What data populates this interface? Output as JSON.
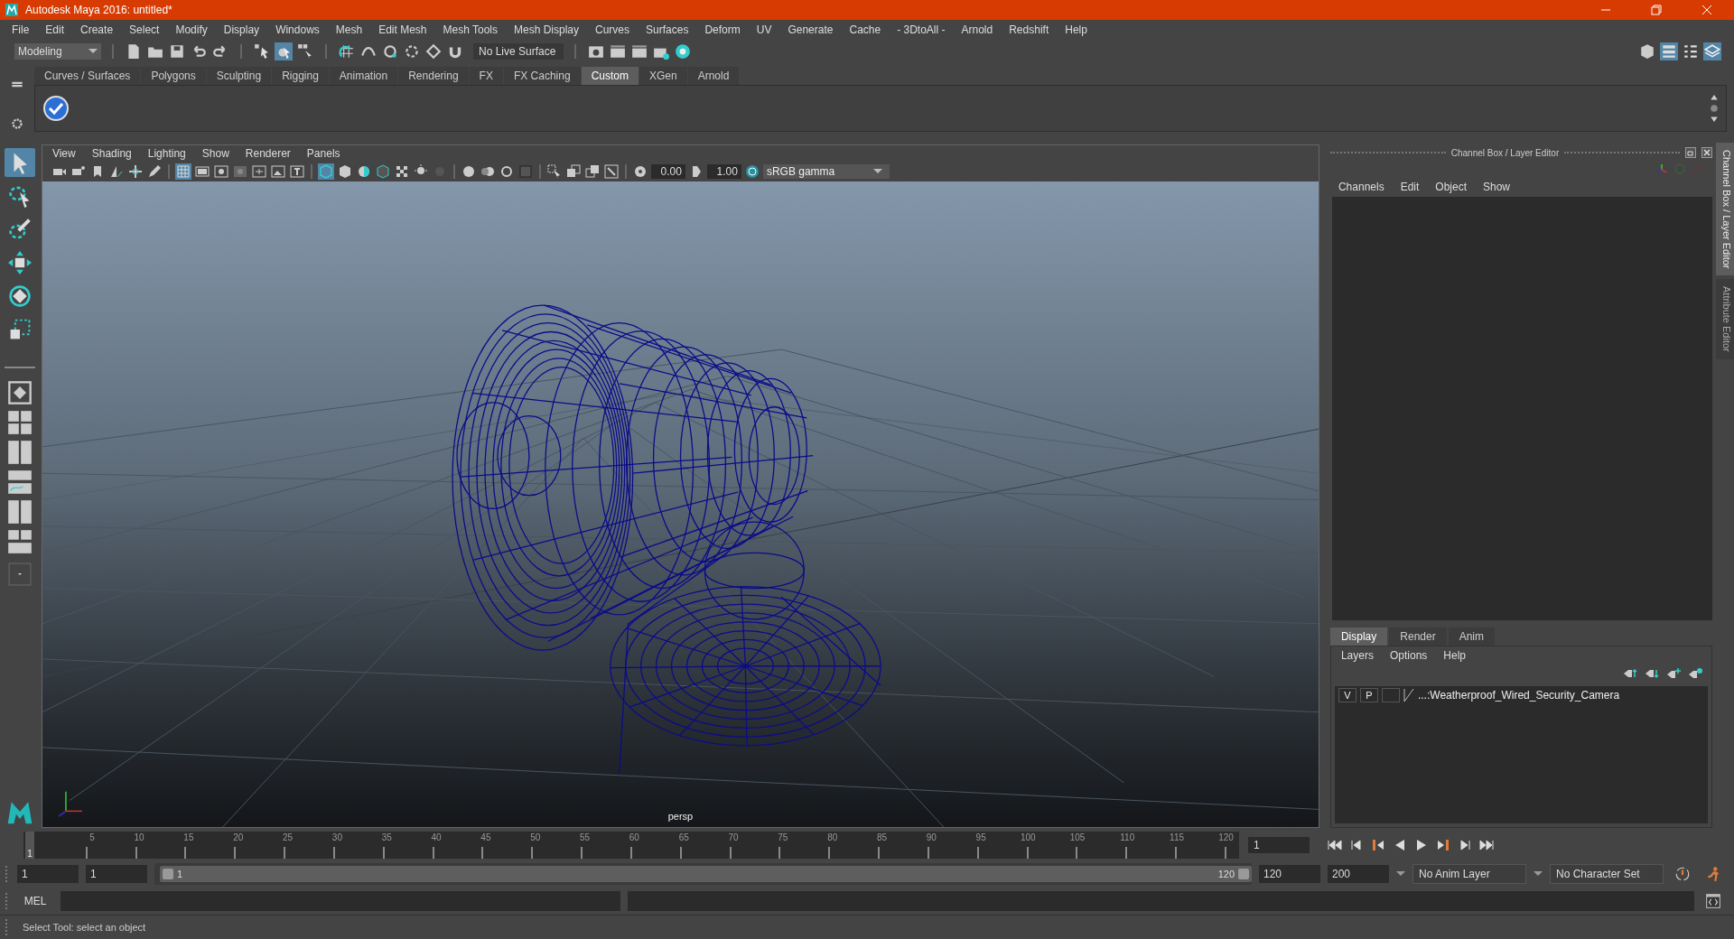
{
  "window": {
    "title": "Autodesk Maya 2016: untitled*"
  },
  "menu_bar": [
    "File",
    "Edit",
    "Create",
    "Select",
    "Modify",
    "Display",
    "Windows",
    "Mesh",
    "Edit Mesh",
    "Mesh Tools",
    "Mesh Display",
    "Curves",
    "Surfaces",
    "Deform",
    "UV",
    "Generate",
    "Cache",
    "- 3DtoAll -",
    "Arnold",
    "Redshift",
    "Help"
  ],
  "status_line": {
    "workspace": "Modeling",
    "live_surface": "No Live Surface"
  },
  "shelf_tabs": [
    {
      "label": "Curves / Surfaces",
      "selected": false
    },
    {
      "label": "Polygons",
      "selected": false
    },
    {
      "label": "Sculpting",
      "selected": false
    },
    {
      "label": "Rigging",
      "selected": false
    },
    {
      "label": "Animation",
      "selected": false
    },
    {
      "label": "Rendering",
      "selected": false
    },
    {
      "label": "FX",
      "selected": false
    },
    {
      "label": "FX Caching",
      "selected": false
    },
    {
      "label": "Custom",
      "selected": true
    },
    {
      "label": "XGen",
      "selected": false
    },
    {
      "label": "Arnold",
      "selected": false
    }
  ],
  "toolbox": [
    {
      "kind": "select",
      "selected": true
    },
    {
      "kind": "lasso",
      "selected": false
    },
    {
      "kind": "paint",
      "selected": false
    },
    {
      "kind": "move",
      "selected": false
    },
    {
      "kind": "rotate",
      "selected": false
    },
    {
      "kind": "scale",
      "selected": false
    }
  ],
  "viewport": {
    "menus": [
      "View",
      "Shading",
      "Lighting",
      "Show",
      "Renderer",
      "Panels"
    ],
    "exposure": "0.00",
    "gamma": "1.00",
    "color_space": "sRGB gamma",
    "camera": "persp"
  },
  "channel_box": {
    "title": "Channel Box / Layer Editor",
    "menus": [
      "Channels",
      "Edit",
      "Object",
      "Show"
    ]
  },
  "layer_editor": {
    "tabs": [
      {
        "label": "Display",
        "selected": true
      },
      {
        "label": "Render",
        "selected": false
      },
      {
        "label": "Anim",
        "selected": false
      }
    ],
    "menus": [
      "Layers",
      "Options",
      "Help"
    ],
    "layers": [
      {
        "visible": "V",
        "playback": "P",
        "name": "...:Weatherproof_Wired_Security_Camera"
      }
    ]
  },
  "side_tabs": [
    {
      "label": "Channel Box / Layer Editor",
      "selected": true
    },
    {
      "label": "Attribute Editor",
      "selected": false
    }
  ],
  "time_slider": {
    "ticks": [
      "5",
      "10",
      "15",
      "20",
      "25",
      "30",
      "35",
      "40",
      "45",
      "50",
      "55",
      "60",
      "65",
      "70",
      "75",
      "80",
      "85",
      "90",
      "95",
      "100",
      "105",
      "110",
      "115",
      "120"
    ],
    "current_frame": "1",
    "level": 0,
    "frame_field": "1"
  },
  "range_slider": {
    "level": 1,
    "start": "1",
    "playback_start": "1",
    "range_start": "1",
    "range_end": "120",
    "playback_end": "120",
    "end": "200",
    "anim_layer": "No Anim Layer",
    "character_set": "No Character Set"
  },
  "command_line": {
    "label": "MEL"
  },
  "help_line": "Select Tool: select an object"
}
